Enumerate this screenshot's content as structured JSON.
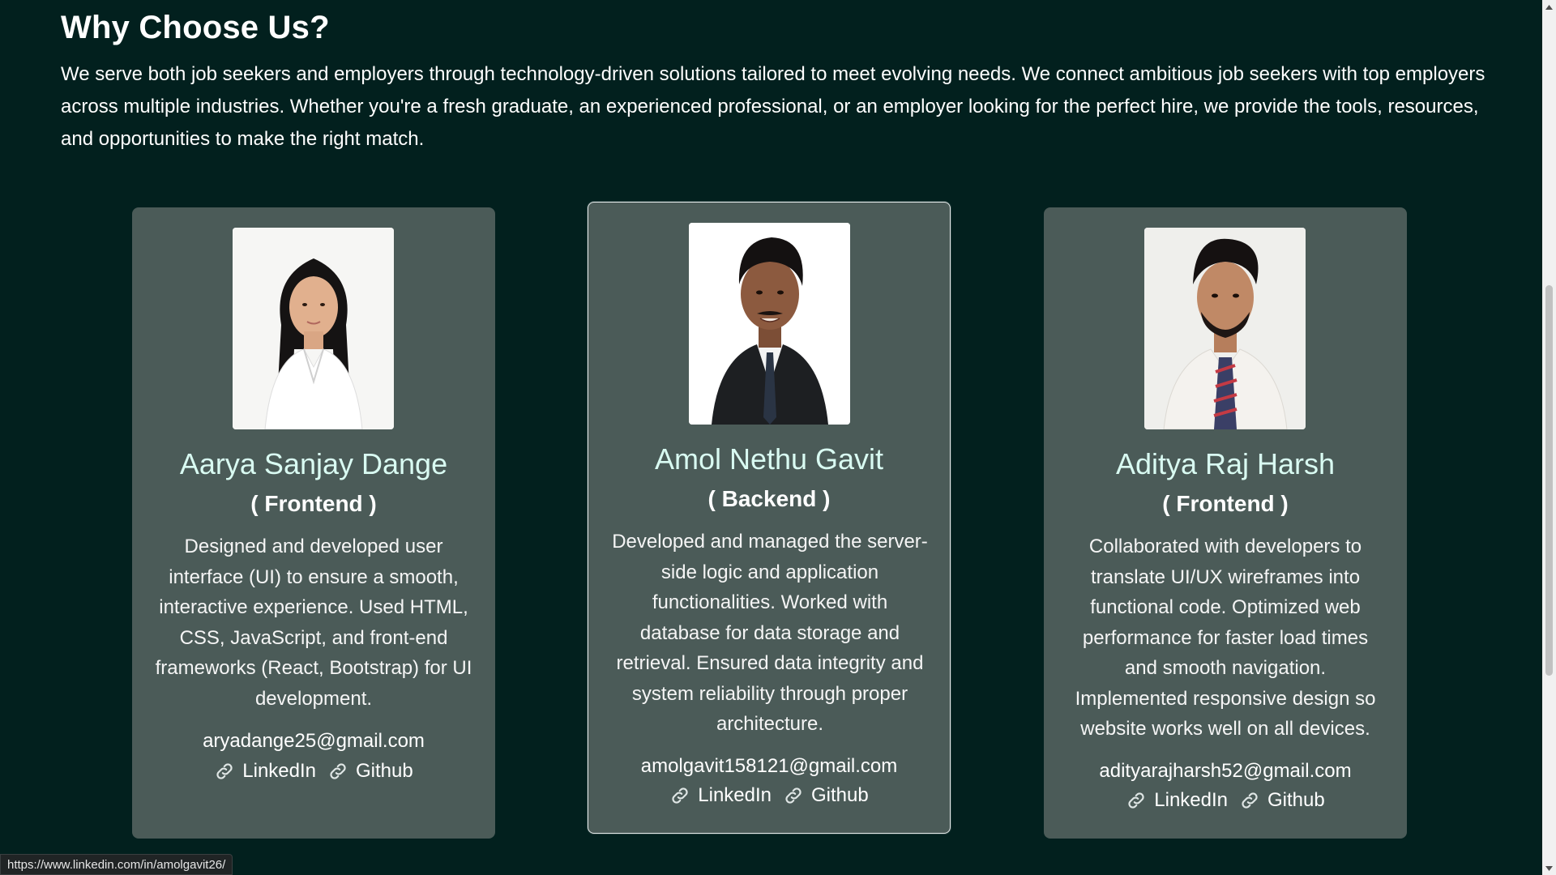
{
  "section": {
    "title": "Why Choose Us?",
    "description": "We serve both job seekers and employers through technology-driven solutions tailored to meet evolving needs. We connect ambitious job seekers with top employers across multiple industries. Whether you're a fresh graduate, an experienced professional, or an employer looking for the perfect hire, we provide the tools, resources, and opportunities to make the right match."
  },
  "team": [
    {
      "name": "Aarya Sanjay Dange",
      "role": "( Frontend )",
      "description": "Designed and developed user interface (UI) to ensure a smooth, interactive experience. Used HTML, CSS, JavaScript, and front-end frameworks (React, Bootstrap) for UI development.",
      "email": "aryadange25@gmail.com",
      "linkedin_label": "LinkedIn",
      "github_label": "Github",
      "photo": "portrait-woman-white-shirt"
    },
    {
      "name": "Amol Nethu Gavit",
      "role": "( Backend )",
      "description": "Developed and managed the server-side logic and application functionalities. Worked with database for data storage and retrieval. Ensured data integrity and system reliability through proper architecture.",
      "email": "amolgavit158121@gmail.com",
      "linkedin_label": "LinkedIn",
      "github_label": "Github",
      "photo": "portrait-man-black-suit"
    },
    {
      "name": "Aditya Raj Harsh",
      "role": "( Frontend )",
      "description": "Collaborated with developers to translate UI/UX wireframes into functional code. Optimized web performance for faster load times and smooth navigation. Implemented responsive design so website works well on all devices.",
      "email": "adityarajharsh52@gmail.com",
      "linkedin_label": "LinkedIn",
      "github_label": "Github",
      "photo": "portrait-man-white-shirt-tie"
    }
  ],
  "status_bar": {
    "url": "https://www.linkedin.com/in/amolgavit26/"
  },
  "colors": {
    "page_background": "#02201e",
    "card_background": "#4b5b58",
    "name_color": "#d9fbf2"
  },
  "icons": {
    "link": "link-icon"
  }
}
